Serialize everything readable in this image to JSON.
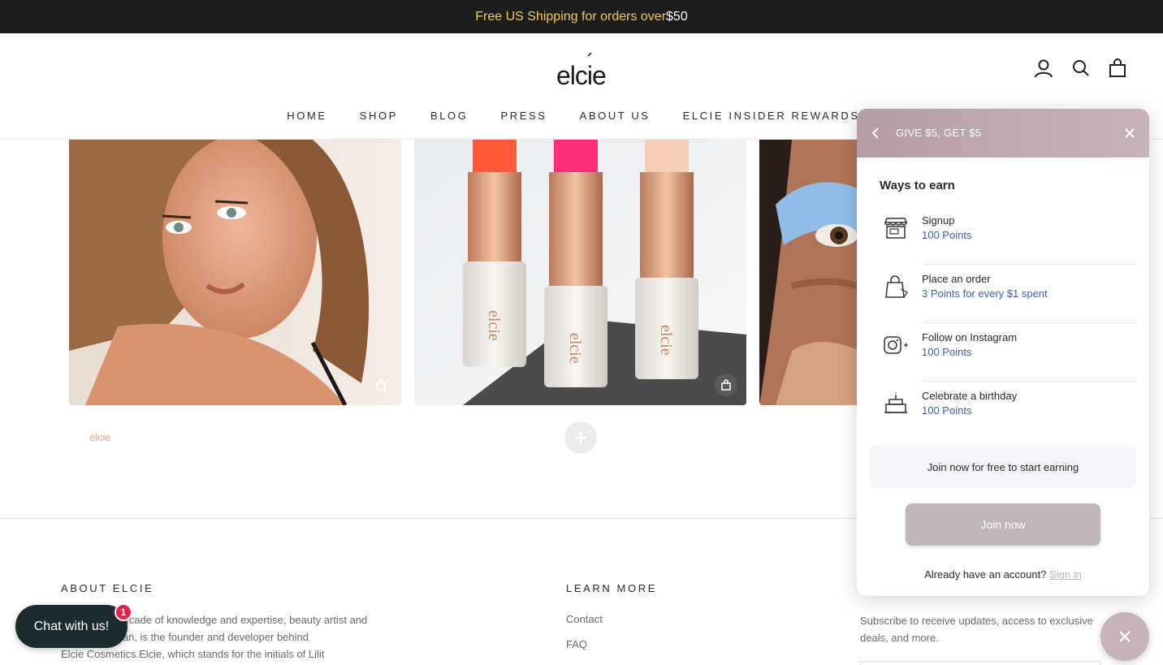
{
  "announcement": {
    "text": "Free US Shipping for orders over ",
    "amount": "$50"
  },
  "header": {
    "logo_text": "elcie",
    "icons": [
      "account-icon",
      "search-icon",
      "cart-icon"
    ]
  },
  "nav": {
    "items": [
      "HOME",
      "SHOP",
      "BLOG",
      "PRESS",
      "ABOUT US",
      "ELCIE INSIDER REWARDS"
    ]
  },
  "footer": {
    "about_heading": "ABOUT ELCIE",
    "about_text": "With over a decade of knowledge and expertise, beauty artist and Lilit Caradanian, is the founder and developer behind Elcie Cosmetics.Elcie, which stands for the initials of Lilit",
    "about_lines": [
      "With over a decade of knowledge and expertise, beauty artist and",
      "Lilit Caradanian, is the founder and developer behind",
      "Elcie Cosmetics.Elcie, which stands for the initials of Lilit"
    ],
    "learn_heading": "LEARN MORE",
    "learn_links": [
      "Contact",
      "FAQ"
    ],
    "newsletter_lines": [
      "Subscribe to receive updates, access to exclusive",
      "deals, and more."
    ]
  },
  "chat": {
    "label": "Chat with us!",
    "badge": "1"
  },
  "rewards_panel": {
    "title": "GIVE $5, GET $5",
    "ways_heading": "Ways to earn",
    "ways": [
      {
        "name": "Signup",
        "points": "100 Points",
        "icon": "storefront-icon"
      },
      {
        "name": "Place an order",
        "points": "3 Points for every $1 spent",
        "icon": "shopping-bag-icon"
      },
      {
        "name": "Follow on Instagram",
        "points": "100 Points",
        "icon": "instagram-icon"
      },
      {
        "name": "Celebrate a birthday",
        "points": "100 Points",
        "icon": "birthday-cake-icon"
      }
    ],
    "join_prompt": "Join now for free to start earning",
    "join_button": "Join now",
    "have_account": "Already have an account?",
    "sign_in": "Sign in"
  },
  "colors": {
    "announce_bg": "#1d1d1d",
    "announce_text": "#f4c95d",
    "panel_header": "#b39ea5",
    "points_text": "#3e62a8",
    "chat_bg": "#1b2b30",
    "badge": "#e8204b"
  }
}
